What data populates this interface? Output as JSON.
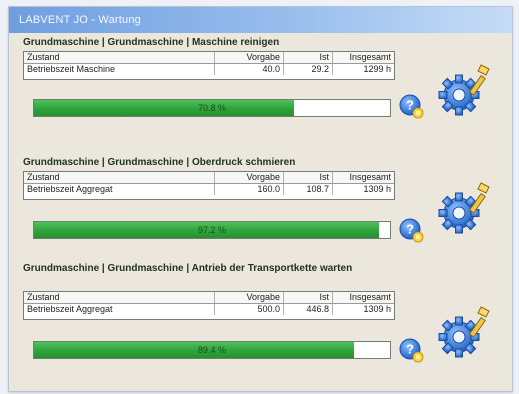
{
  "window": {
    "title": "LABVENT JO - Wartung"
  },
  "columns": {
    "state": "Zustand",
    "vorgabe": "Vorgabe",
    "ist": "Ist",
    "insgesamt": "Insgesamt"
  },
  "tasks": [
    {
      "title": "Grundmaschine | Grundmaschine | Maschine reinigen",
      "row": {
        "state": "Betriebszeit Maschine",
        "vorgabe": "40.0",
        "ist": "29.2",
        "insgesamt": "1299 h"
      },
      "progress_text": "70.8 %",
      "progress_fraction": 0.73
    },
    {
      "title": "Grundmaschine | Grundmaschine | Oberdruck schmieren",
      "row": {
        "state": "Betriebszeit Aggregat",
        "vorgabe": "160.0",
        "ist": "108.7",
        "insgesamt": "1309 h"
      },
      "progress_text": "97.2 %",
      "progress_fraction": 0.97
    },
    {
      "title": "Grundmaschine | Grundmaschine | Antrieb der Transportkette warten",
      "row": {
        "state": "Betriebszeit Aggregat",
        "vorgabe": "500.0",
        "ist": "446.8",
        "insgesamt": "1309 h"
      },
      "progress_text": "89.4 %",
      "progress_fraction": 0.9
    }
  ],
  "colors": {
    "title_bar": "#7aa7e3",
    "progress_fill": "#2ea33b",
    "panel": "#ebe7dd"
  },
  "icons": {
    "help": "help-icon",
    "maintenance": "gear-wrench-icon"
  }
}
